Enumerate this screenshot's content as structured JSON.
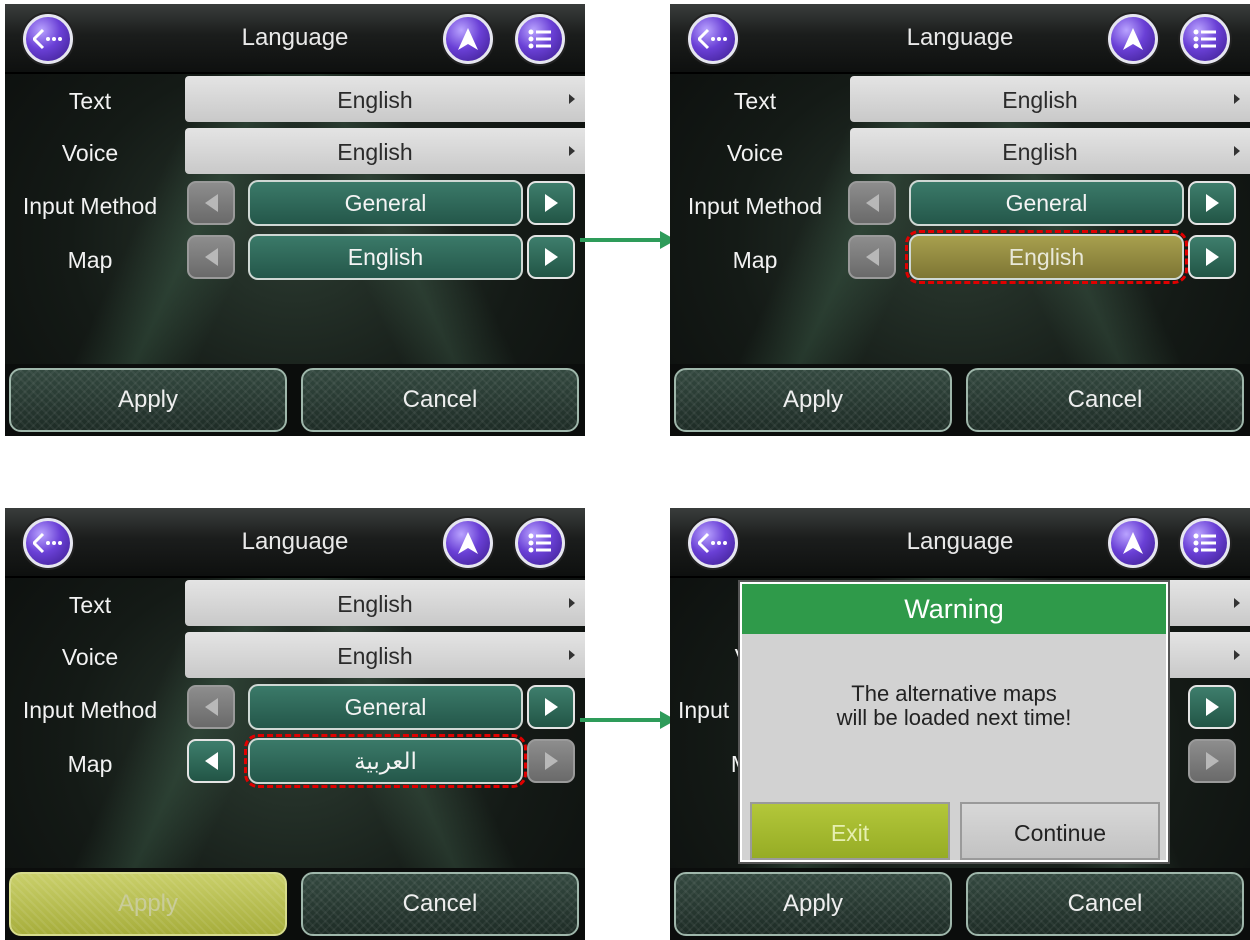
{
  "panels": [
    {
      "title": "Language",
      "rows": [
        {
          "label": "Text",
          "value": "English"
        },
        {
          "label": "Voice",
          "value": "English"
        },
        {
          "label": "Input Method",
          "value": "General"
        },
        {
          "label": "Map",
          "value": "English"
        }
      ],
      "apply": "Apply",
      "cancel": "Cancel"
    },
    {
      "title": "Language",
      "rows": [
        {
          "label": "Text",
          "value": "English"
        },
        {
          "label": "Voice",
          "value": "English"
        },
        {
          "label": "Input Method",
          "value": "General"
        },
        {
          "label": "Map",
          "value": "English"
        }
      ],
      "apply": "Apply",
      "cancel": "Cancel"
    },
    {
      "title": "Language",
      "rows": [
        {
          "label": "Text",
          "value": "English"
        },
        {
          "label": "Voice",
          "value": "English"
        },
        {
          "label": "Input Method",
          "value": "General"
        },
        {
          "label": "Map",
          "value": "العربية"
        }
      ],
      "apply": "Apply",
      "cancel": "Cancel"
    },
    {
      "title": "Language",
      "rows": [
        {
          "label": "T",
          "value": ""
        },
        {
          "label": "V",
          "value": ""
        },
        {
          "label": "Input",
          "value": ""
        },
        {
          "label": "M",
          "value": ""
        }
      ],
      "apply": "Apply",
      "cancel": "Cancel",
      "dialog": {
        "title": "Warning",
        "message_line1": "The alternative maps",
        "message_line2": "will be loaded next time!",
        "exit": "Exit",
        "continue": "Continue"
      }
    }
  ],
  "colors": {
    "connector_arrow": "#2e9c5a",
    "highlight_dash": "#e00000",
    "dialog_title_bg": "#2f9a4a",
    "exit_button_bg": "#a9bd30"
  },
  "icons": [
    "back-ellipsis-icon",
    "navigation-arrow-icon",
    "menu-list-icon",
    "triangle-right-icon",
    "arrow-left-icon",
    "arrow-right-icon"
  ]
}
